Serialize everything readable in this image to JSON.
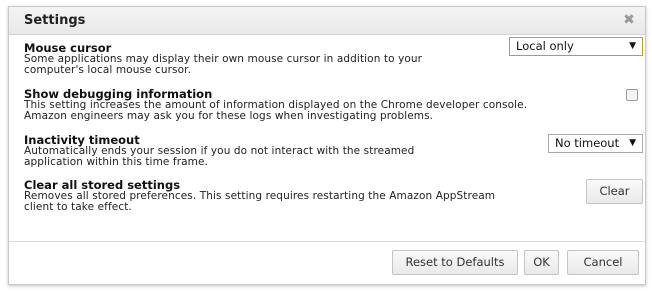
{
  "dialog": {
    "title": "Settings",
    "close_icon": "close-icon"
  },
  "settings": [
    {
      "title": "Mouse cursor",
      "line1": "Some applications may display their own mouse cursor in addition to your",
      "line2": "computer's local mouse cursor.",
      "control": {
        "type": "select",
        "value": "Local only"
      }
    },
    {
      "title": "Show debugging information",
      "line1": "This setting increases the amount of information displayed on the Chrome developer console.",
      "line2": "Amazon engineers may ask you for these logs when investigating problems.",
      "control": {
        "type": "checkbox",
        "checked": false
      }
    },
    {
      "title": "Inactivity timeout",
      "line1": "Automatically ends your session if you do not interact with the streamed",
      "line2": "application within this time frame.",
      "control": {
        "type": "select",
        "value": "No timeout"
      }
    },
    {
      "title": "Clear all stored settings",
      "line1": "Removes all stored preferences. This setting requires restarting the Amazon AppStream",
      "line2": "client to take effect.",
      "control": {
        "type": "button",
        "label": "Clear"
      }
    }
  ],
  "footer": {
    "reset_label": "Reset to Defaults",
    "ok_label": "OK",
    "cancel_label": "Cancel"
  },
  "icons": {
    "dropdown_arrow": "▼"
  },
  "colors": {
    "select_focus_border": "#c49b2a",
    "titlebar_bg": "#ececec"
  }
}
